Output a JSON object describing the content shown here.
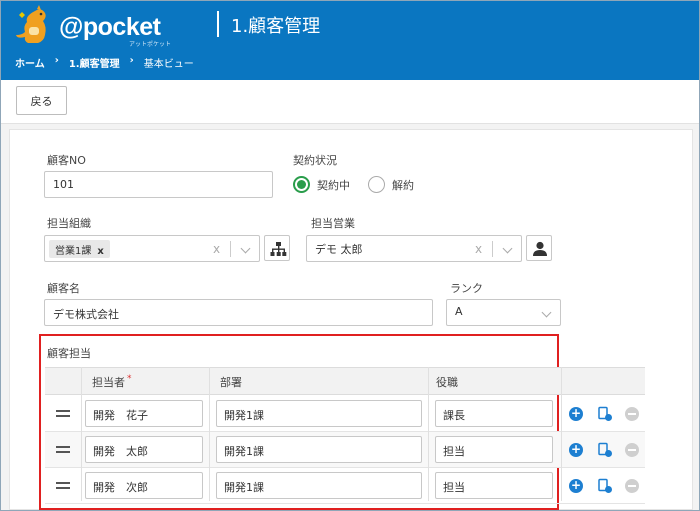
{
  "header": {
    "brand": "@pocket",
    "brand_sub": "アットポケット",
    "page_title": "1.顧客管理",
    "breadcrumb": [
      "ホーム",
      "1.顧客管理",
      "基本ビュー"
    ],
    "breadcrumb_sep": "›"
  },
  "toolbar": {
    "back_label": "戻る"
  },
  "form": {
    "customer_no": {
      "label": "顧客NO",
      "value": "101"
    },
    "contract": {
      "label": "契約状況",
      "options": [
        "契約中",
        "解約"
      ],
      "selected": "契約中"
    },
    "org": {
      "label": "担当組織",
      "chip": "営業1課",
      "chip_remove": "x",
      "clear": "x"
    },
    "sales": {
      "label": "担当営業",
      "value": "デモ 太郎",
      "clear": "x"
    },
    "customer_name": {
      "label": "顧客名",
      "value": "デモ株式会社"
    },
    "rank": {
      "label": "ランク",
      "value": "A"
    }
  },
  "contacts": {
    "label": "顧客担当",
    "columns": [
      "担当者",
      "部署",
      "役職"
    ],
    "required_mark": "*",
    "add_symbol": "+",
    "rows": [
      {
        "name": "開発　花子",
        "dept": "開発1課",
        "role": "課長"
      },
      {
        "name": "開発　太郎",
        "dept": "開発1課",
        "role": "担当"
      },
      {
        "name": "開発　次郎",
        "dept": "開発1課",
        "role": "担当"
      }
    ]
  },
  "colors": {
    "header": "#0a76c1",
    "accent": "#1d7fd1",
    "radio": "#2a9d4b",
    "highlight": "#e02020"
  },
  "icons": [
    "kangaroo-logo-icon",
    "org-tree-icon",
    "person-icon",
    "chevron-down-icon",
    "plus-circle-icon",
    "copy-add-icon",
    "minus-circle-icon",
    "drag-handle-icon"
  ]
}
